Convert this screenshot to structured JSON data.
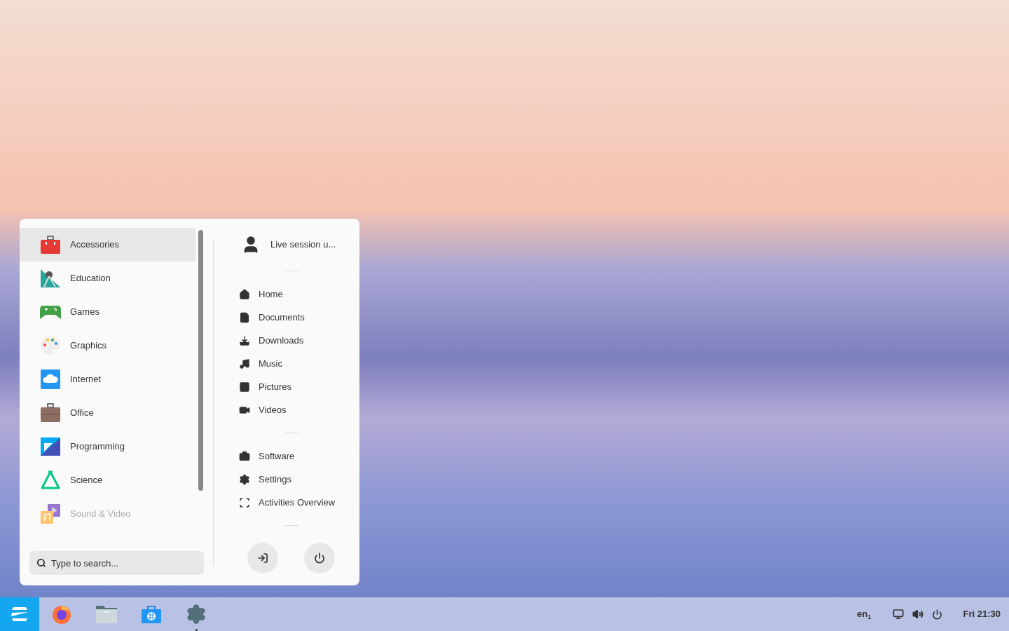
{
  "menu": {
    "categories": [
      {
        "label": "Accessories",
        "kind": "toolbox",
        "selected": true,
        "faded": false
      },
      {
        "label": "Education",
        "kind": "education",
        "selected": false,
        "faded": false
      },
      {
        "label": "Games",
        "kind": "gamepad",
        "selected": false,
        "faded": false
      },
      {
        "label": "Graphics",
        "kind": "palette",
        "selected": false,
        "faded": false
      },
      {
        "label": "Internet",
        "kind": "cloud",
        "selected": false,
        "faded": false
      },
      {
        "label": "Office",
        "kind": "briefcase",
        "selected": false,
        "faded": false
      },
      {
        "label": "Programming",
        "kind": "programming",
        "selected": false,
        "faded": false
      },
      {
        "label": "Science",
        "kind": "flask",
        "selected": false,
        "faded": false
      },
      {
        "label": "Sound & Video",
        "kind": "media",
        "selected": false,
        "faded": true
      }
    ],
    "search": {
      "placeholder": "Type to search..."
    },
    "user": {
      "name": "Live session u..."
    },
    "places": [
      {
        "label": "Home",
        "kind": "home"
      },
      {
        "label": "Documents",
        "kind": "document"
      },
      {
        "label": "Downloads",
        "kind": "download"
      },
      {
        "label": "Music",
        "kind": "music"
      },
      {
        "label": "Pictures",
        "kind": "picture"
      },
      {
        "label": "Videos",
        "kind": "video"
      }
    ],
    "system": [
      {
        "label": "Software",
        "kind": "bag"
      },
      {
        "label": "Settings",
        "kind": "gear"
      },
      {
        "label": "Activities Overview",
        "kind": "overview"
      }
    ],
    "actions": [
      {
        "kind": "logout"
      },
      {
        "kind": "power"
      }
    ]
  },
  "taskbar": {
    "apps": [
      {
        "kind": "zorin",
        "running": false
      },
      {
        "kind": "browser",
        "running": false
      },
      {
        "kind": "files",
        "running": false
      },
      {
        "kind": "store",
        "running": false
      },
      {
        "kind": "settings",
        "running": true
      }
    ],
    "keyboard_layout": "en$_{1}$",
    "clock": "Fri 21:30"
  }
}
